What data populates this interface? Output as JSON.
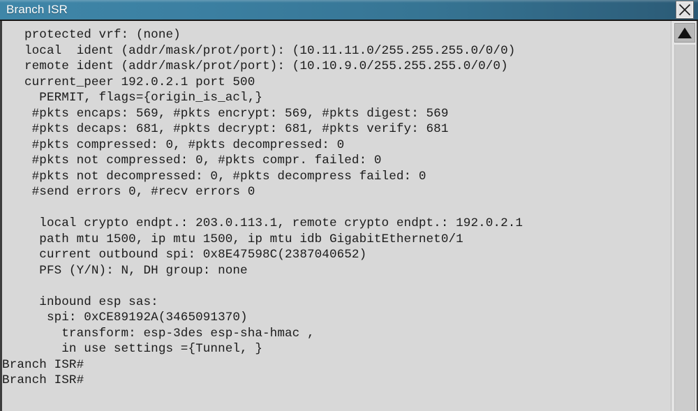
{
  "window": {
    "title": "Branch ISR",
    "close_label": "✕",
    "close_icon": "close-icon"
  },
  "scrollbar": {
    "up_arrow_icon": "triangle-up-icon"
  },
  "console": {
    "lines": [
      "   protected vrf: (none)",
      "   local  ident (addr/mask/prot/port): (10.11.11.0/255.255.255.0/0/0)",
      "   remote ident (addr/mask/prot/port): (10.10.9.0/255.255.255.0/0/0)",
      "   current_peer 192.0.2.1 port 500",
      "     PERMIT, flags={origin_is_acl,}",
      "    #pkts encaps: 569, #pkts encrypt: 569, #pkts digest: 569",
      "    #pkts decaps: 681, #pkts decrypt: 681, #pkts verify: 681",
      "    #pkts compressed: 0, #pkts decompressed: 0",
      "    #pkts not compressed: 0, #pkts compr. failed: 0",
      "    #pkts not decompressed: 0, #pkts decompress failed: 0",
      "    #send errors 0, #recv errors 0",
      "",
      "     local crypto endpt.: 203.0.113.1, remote crypto endpt.: 192.0.2.1",
      "     path mtu 1500, ip mtu 1500, ip mtu idb GigabitEthernet0/1",
      "     current outbound spi: 0x8E47598C(2387040652)",
      "     PFS (Y/N): N, DH group: none",
      "",
      "     inbound esp sas:",
      "      spi: 0xCE89192A(3465091370)",
      "        transform: esp-3des esp-sha-hmac ,",
      "        in use settings ={Tunnel, }",
      "Branch ISR#",
      "Branch ISR#"
    ],
    "text": "   protected vrf: (none)\n   local  ident (addr/mask/prot/port): (10.11.11.0/255.255.255.0/0/0)\n   remote ident (addr/mask/prot/port): (10.10.9.0/255.255.255.0/0/0)\n   current_peer 192.0.2.1 port 500\n     PERMIT, flags={origin_is_acl,}\n    #pkts encaps: 569, #pkts encrypt: 569, #pkts digest: 569\n    #pkts decaps: 681, #pkts decrypt: 681, #pkts verify: 681\n    #pkts compressed: 0, #pkts decompressed: 0\n    #pkts not compressed: 0, #pkts compr. failed: 0\n    #pkts not decompressed: 0, #pkts decompress failed: 0\n    #send errors 0, #recv errors 0\n\n     local crypto endpt.: 203.0.113.1, remote crypto endpt.: 192.0.2.1\n     path mtu 1500, ip mtu 1500, ip mtu idb GigabitEthernet0/1\n     current outbound spi: 0x8E47598C(2387040652)\n     PFS (Y/N): N, DH group: none\n\n     inbound esp sas:\n      spi: 0xCE89192A(3465091370)\n        transform: esp-3des esp-sha-hmac ,\n        in use settings ={Tunnel, }\nBranch ISR#\nBranch ISR#",
    "values": {
      "protected_vrf": "(none)",
      "local_ident": "(10.11.11.0/255.255.255.0/0/0)",
      "remote_ident": "(10.10.9.0/255.255.255.0/0/0)",
      "current_peer": "192.0.2.1",
      "peer_port": "500",
      "flags": "{origin_is_acl,}",
      "pkts_encaps": "569",
      "pkts_encrypt": "569",
      "pkts_digest": "569",
      "pkts_decaps": "681",
      "pkts_decrypt": "681",
      "pkts_verify": "681",
      "pkts_compressed": "0",
      "pkts_decompressed": "0",
      "pkts_not_compressed": "0",
      "pkts_compr_failed": "0",
      "pkts_not_decompressed": "0",
      "pkts_decompress_failed": "0",
      "send_errors": "0",
      "recv_errors": "0",
      "local_crypto_endpt": "203.0.113.1",
      "remote_crypto_endpt": "192.0.2.1",
      "path_mtu": "1500",
      "ip_mtu": "1500",
      "ip_mtu_idb": "GigabitEthernet0/1",
      "current_outbound_spi": "0x8E47598C(2387040652)",
      "pfs": "N",
      "dh_group": "none",
      "inbound_esp_spi": "0xCE89192A(3465091370)",
      "transform": "esp-3des esp-sha-hmac ,",
      "in_use_settings": "={Tunnel, }",
      "prompt": "Branch ISR#"
    }
  },
  "colors": {
    "titlebar_left": "#3f86a8",
    "titlebar_right": "#2b5a75",
    "console_bg": "#d8d8d8",
    "console_text": "#1b1b1b",
    "frame_border": "#3d3d3d",
    "scrollbar_track": "#cccccc",
    "scrollbar_button": "#b8b8b8"
  }
}
